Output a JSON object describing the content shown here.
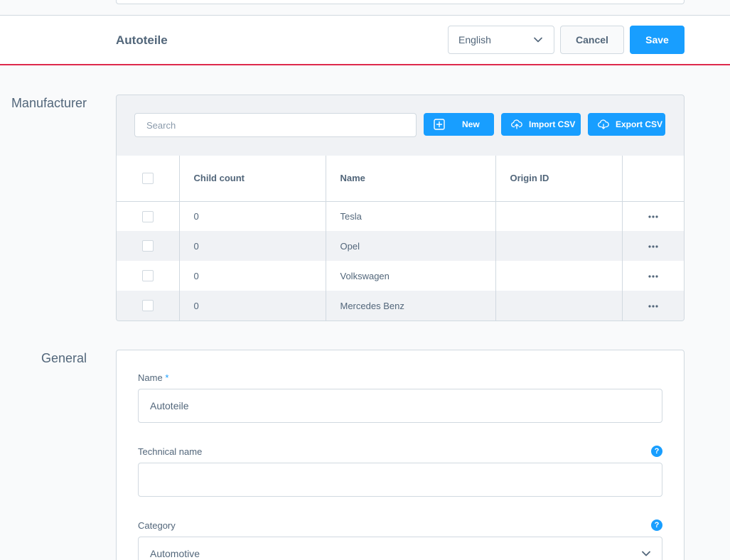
{
  "smartbar": {
    "title": "Autoteile",
    "language": "English",
    "cancel_label": "Cancel",
    "save_label": "Save"
  },
  "sections": {
    "manufacturer_label": "Manufacturer",
    "general_label": "General"
  },
  "manufacturer": {
    "search_placeholder": "Search",
    "new_label": "New",
    "import_label": "Import CSV",
    "export_label": "Export CSV",
    "columns": [
      "Child count",
      "Name",
      "Origin ID"
    ],
    "rows": [
      {
        "child_count": "0",
        "name": "Tesla",
        "origin_id": ""
      },
      {
        "child_count": "0",
        "name": "Opel",
        "origin_id": ""
      },
      {
        "child_count": "0",
        "name": "Volkswagen",
        "origin_id": ""
      },
      {
        "child_count": "0",
        "name": "Mercedes Benz",
        "origin_id": ""
      }
    ]
  },
  "general": {
    "name_label": "Name",
    "name_required": "*",
    "name_value": "Autoteile",
    "technical_name_label": "Technical name",
    "technical_name_value": "",
    "category_label": "Category",
    "category_value": "Automotive",
    "help_glyph": "?"
  },
  "colors": {
    "accent": "#189eff",
    "smartbar_border": "#de294c",
    "border": "#d1d9e0",
    "text": "#52667a"
  }
}
